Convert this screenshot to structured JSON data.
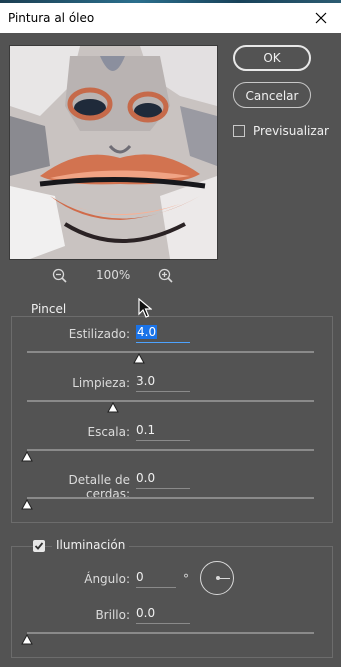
{
  "window": {
    "title": "Pintura al óleo"
  },
  "buttons": {
    "ok": "OK",
    "cancel": "Cancelar"
  },
  "preview": {
    "checkbox_label": "Previsualizar",
    "checked": false,
    "zoom_level": "100%"
  },
  "brush": {
    "group_title": "Pincel",
    "sliders": [
      {
        "label": "Estilizado:",
        "value": "4.0",
        "fraction": 0.39
      },
      {
        "label": "Limpieza:",
        "value": "3.0",
        "fraction": 0.3
      },
      {
        "label": "Escala:",
        "value": "0.1",
        "fraction": 0.0
      },
      {
        "label": "Detalle de cerdas:",
        "value": "0.0",
        "fraction": 0.0
      }
    ]
  },
  "lighting": {
    "group_title": "Iluminación",
    "checked": true,
    "angle": {
      "label": "Ángulo:",
      "value": "0",
      "unit": "°"
    },
    "brightness": {
      "label": "Brillo:",
      "value": "0.0",
      "fraction": 0.0
    }
  },
  "icons": [
    "close-icon",
    "zoom-out-icon",
    "zoom-in-icon",
    "checkmark-icon",
    "mouse-cursor-icon",
    "angle-dial-icon"
  ]
}
